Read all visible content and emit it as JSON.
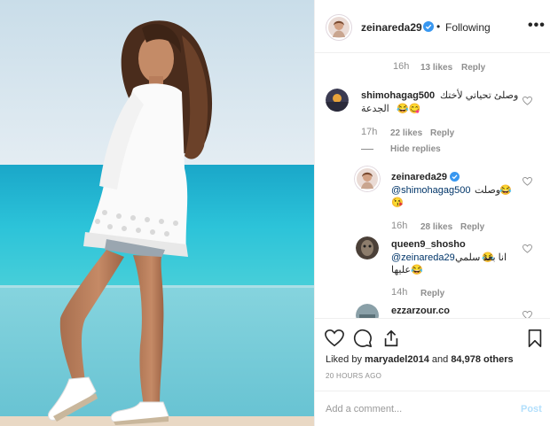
{
  "post": {
    "username": "zeinareda29",
    "dot": "•",
    "follow_status": "Following",
    "more_label": "•••"
  },
  "comments": [
    {
      "time": "16h",
      "likes": "13 likes",
      "reply": "Reply"
    },
    {
      "username": "shimohagag500",
      "text_line1": "وصلئ تحياتي لأختك",
      "text_line2": "الجدعة",
      "emoji": "😂😋",
      "time": "17h",
      "likes": "22 likes",
      "reply": "Reply",
      "hide_replies": "Hide replies"
    },
    {
      "username": "zeinareda29",
      "mention": "@shimohagag500",
      "text": "وصلت",
      "emoji": "😂",
      "emoji2": "😘",
      "time": "16h",
      "likes": "28 likes",
      "reply": "Reply"
    },
    {
      "username": "queen9_shosho",
      "mention": "@zeinareda29",
      "text": "انا بعد سلمي",
      "emoji": "😂",
      "text_line2": "عليها",
      "emoji2": "😂",
      "time": "14h",
      "reply": "Reply"
    },
    {
      "username": "ezzarzour.co"
    }
  ],
  "footer": {
    "liked_prefix": "Liked by",
    "liked_user": "maryadel2014",
    "liked_and": "and",
    "liked_count": "84,978 others",
    "timestamp": "20 HOURS AGO",
    "add_comment_placeholder": "Add a comment...",
    "post_button": "Post"
  },
  "colors": {
    "sky": "#dde9f1",
    "sea": "#25b7d3",
    "verified": "#3897f0",
    "post_disabled": "#b2dffc"
  },
  "icons": [
    "verified-badge-icon",
    "heart-icon",
    "comment-icon",
    "share-icon",
    "bookmark-icon",
    "more-options-icon"
  ]
}
